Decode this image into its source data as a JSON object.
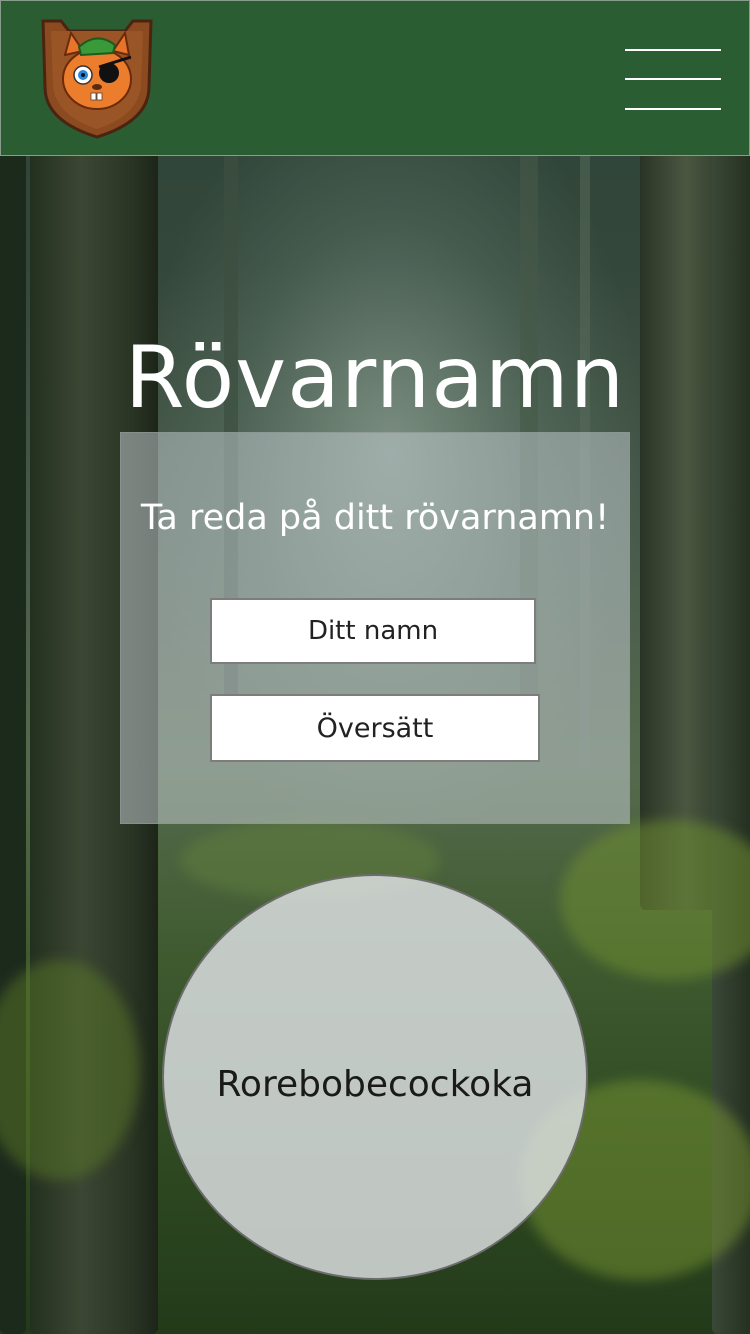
{
  "header": {
    "logo_alt": "Squirrel pirate logo",
    "menu_icon": "hamburger-menu-icon"
  },
  "main": {
    "title": "Rövarnamn",
    "prompt": "Ta reda på ditt rövarnamn!",
    "name_input": {
      "value": "",
      "placeholder": "Ditt namn"
    },
    "translate_label": "Översätt",
    "result": "Rorebobecockoka"
  },
  "colors": {
    "header_bg": "#2b5d33",
    "text_light": "#ffffff",
    "text_dark": "#222222"
  }
}
